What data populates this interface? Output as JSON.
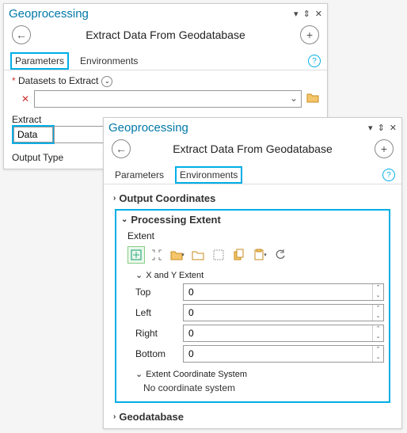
{
  "back": {
    "title": "Geoprocessing",
    "tool_title": "Extract Data From Geodatabase",
    "tabs": {
      "parameters": "Parameters",
      "environments": "Environments"
    },
    "datasets_label": "Datasets to Extract",
    "extract_label": "Extract",
    "extract_value": "Data",
    "output_type_label": "Output Type"
  },
  "front": {
    "title": "Geoprocessing",
    "tool_title": "Extract Data From Geodatabase",
    "tabs": {
      "parameters": "Parameters",
      "environments": "Environments"
    },
    "sections": {
      "output_coords": "Output Coordinates",
      "processing_extent": "Processing Extent",
      "geodatabase": "Geodatabase"
    },
    "extent": {
      "label": "Extent",
      "xy_header": "X and Y Extent",
      "top_label": "Top",
      "top": "0",
      "left_label": "Left",
      "left": "0",
      "right_label": "Right",
      "right": "0",
      "bottom_label": "Bottom",
      "bottom": "0",
      "cs_header": "Extent Coordinate System",
      "cs_value": "No coordinate system"
    }
  }
}
